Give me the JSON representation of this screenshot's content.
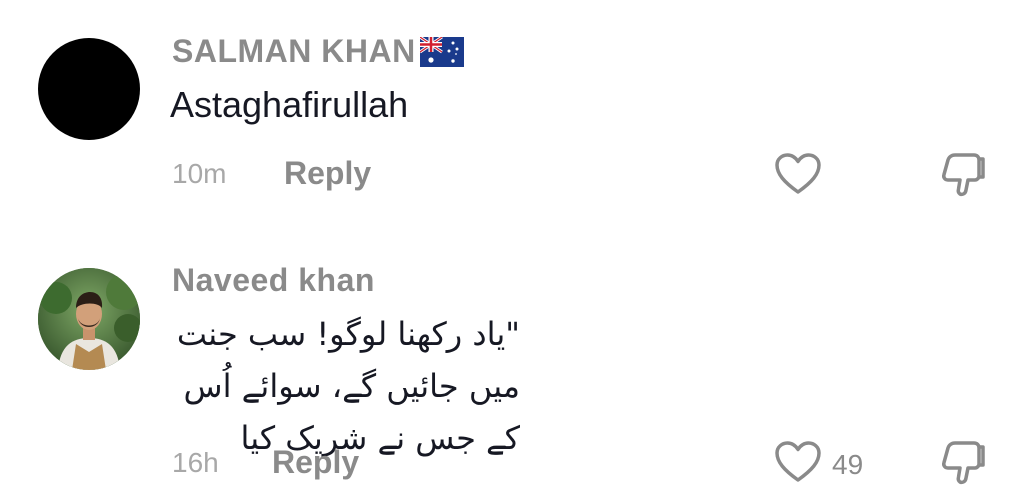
{
  "comments": [
    {
      "username": "SALMAN KHAN",
      "flag": "australia-flag-icon",
      "text": "Astaghafirullah",
      "time": "10m",
      "reply_label": "Reply",
      "like_count": ""
    },
    {
      "username": "Naveed khan",
      "text_line1": "\"یاد رکھنا لوگو! سب جنت میں جائیں گے، سوائے اُس",
      "text_line2": "کے جس نے شریک کیا",
      "time": "16h",
      "reply_label": "Reply",
      "like_count": "49"
    }
  ],
  "colors": {
    "username": "#8a8a8a",
    "text": "#161823",
    "meta": "#a8a8a8"
  }
}
